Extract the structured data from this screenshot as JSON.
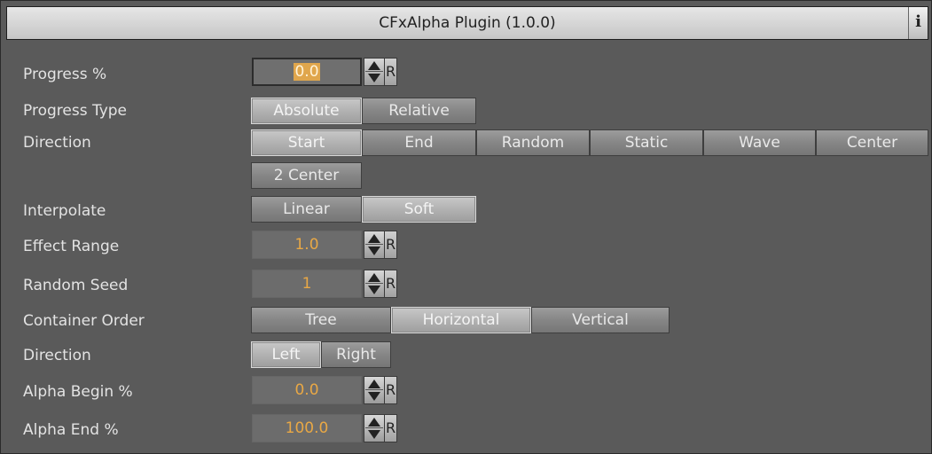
{
  "window": {
    "title": "CFxAlpha Plugin (1.0.0)",
    "info_label": "i"
  },
  "progress": {
    "label": "Progress %",
    "value": "0.0",
    "reset_label": "R"
  },
  "progress_type": {
    "label": "Progress Type",
    "options": [
      "Absolute",
      "Relative"
    ],
    "selected": "Absolute"
  },
  "direction": {
    "label": "Direction",
    "options": [
      "Start",
      "End",
      "Random",
      "Static",
      "Wave",
      "Center",
      "2 Center"
    ],
    "selected": "Start"
  },
  "interpolate": {
    "label": "Interpolate",
    "options": [
      "Linear",
      "Soft"
    ],
    "selected": "Soft"
  },
  "effect_range": {
    "label": "Effect Range",
    "value": "1.0",
    "reset_label": "R"
  },
  "random_seed": {
    "label": "Random Seed",
    "value": "1",
    "reset_label": "R"
  },
  "container_order": {
    "label": "Container Order",
    "options": [
      "Tree",
      "Horizontal",
      "Vertical"
    ],
    "selected": "Horizontal"
  },
  "direction2": {
    "label": "Direction",
    "options": [
      "Left",
      "Right"
    ],
    "selected": "Left"
  },
  "alpha_begin": {
    "label": "Alpha Begin %",
    "value": "0.0",
    "reset_label": "R"
  },
  "alpha_end": {
    "label": "Alpha End %",
    "value": "100.0",
    "reset_label": "R"
  },
  "colors": {
    "value_text": "#f0b34a",
    "panel_bg": "#5a5a5a",
    "label_text": "#e3e3e3"
  },
  "icons": {
    "spinner": "up-down-arrows-icon",
    "info": "info-icon"
  }
}
